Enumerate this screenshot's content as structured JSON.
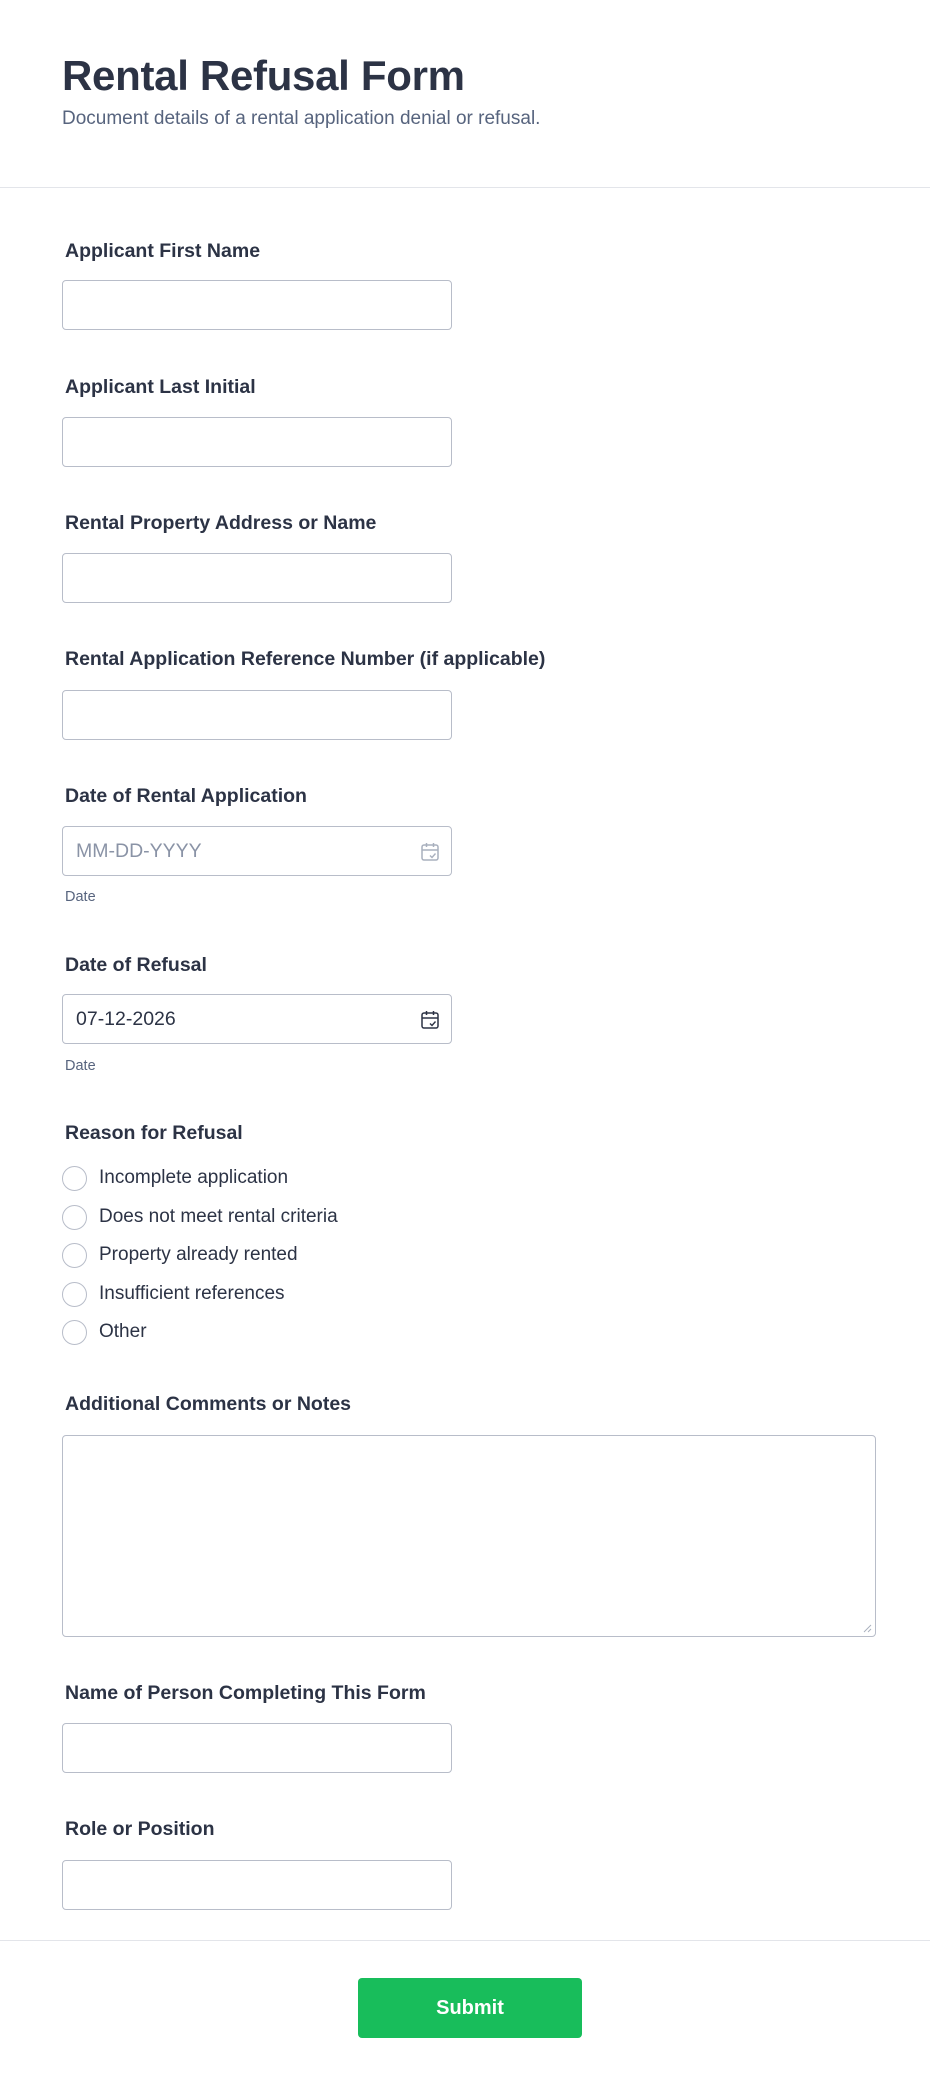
{
  "header": {
    "title": "Rental Refusal Form",
    "subtitle": "Document details of a rental application denial or refusal."
  },
  "fields": {
    "first_name": {
      "label": "Applicant First Name",
      "value": ""
    },
    "last_initial": {
      "label": "Applicant Last Initial",
      "value": ""
    },
    "property": {
      "label": "Rental Property Address or Name",
      "value": ""
    },
    "reference": {
      "label": "Rental Application Reference Number (if applicable)",
      "value": ""
    },
    "application_date": {
      "label": "Date of Rental Application",
      "placeholder": "MM-DD-YYYY",
      "sublabel": "Date"
    },
    "refusal_date": {
      "label": "Date of Refusal",
      "value": "07-12-2026",
      "sublabel": "Date"
    },
    "reason": {
      "label": "Reason for Refusal",
      "options": [
        "Incomplete application",
        "Does not meet rental criteria",
        "Property already rented",
        "Insufficient references",
        "Other"
      ]
    },
    "comments": {
      "label": "Additional Comments or Notes",
      "value": ""
    },
    "completed_by": {
      "label": "Name of Person Completing This Form",
      "value": ""
    },
    "role": {
      "label": "Role or Position",
      "value": ""
    }
  },
  "footer": {
    "submit_label": "Submit"
  },
  "colors": {
    "submit": "#18bd5b",
    "text": "#2c3345",
    "muted": "#57647e",
    "border": "#b8bdc9"
  },
  "icons": {
    "date_picker": "calendar-icon"
  }
}
